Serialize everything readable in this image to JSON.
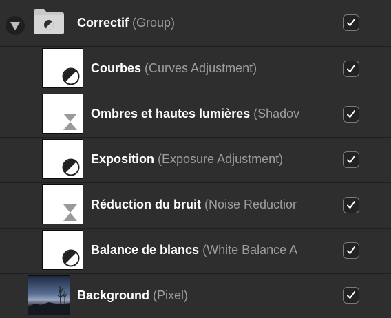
{
  "layers": {
    "group": {
      "name": "Correctif",
      "type": "(Group)",
      "visible": true,
      "expanded": true,
      "icon": "folder-adjustment-icon"
    },
    "children": [
      {
        "name": "Courbes",
        "type": "(Curves Adjustment)",
        "visible": true,
        "icon": "adjustment-icon"
      },
      {
        "name": "Ombres et hautes lumières",
        "type": "(Shadov",
        "visible": true,
        "icon": "hourglass-icon"
      },
      {
        "name": "Exposition",
        "type": "(Exposure Adjustment)",
        "visible": true,
        "icon": "adjustment-icon"
      },
      {
        "name": "Réduction du bruit",
        "type": "(Noise Reductior",
        "visible": true,
        "icon": "hourglass-icon"
      },
      {
        "name": "Balance de blancs",
        "type": "(White Balance A",
        "visible": true,
        "icon": "adjustment-icon"
      }
    ],
    "background": {
      "name": "Background",
      "type": "(Pixel)",
      "visible": true,
      "icon": "pixel-thumbnail"
    }
  },
  "colors": {
    "panel_bg": "#2e2e2e",
    "divider": "#1f1f1f",
    "type_text": "#9d9d9d",
    "checkbox_border": "#7a7a7a"
  }
}
